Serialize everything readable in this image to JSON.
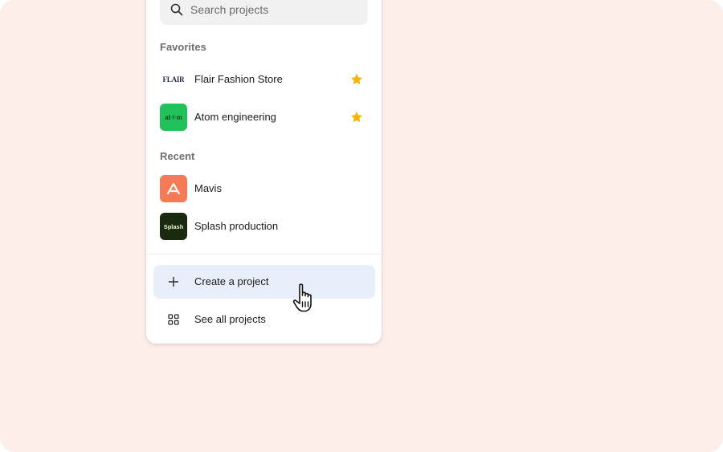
{
  "search": {
    "placeholder": "Search projects",
    "icon": "search-icon"
  },
  "favorites": {
    "label": "Favorites",
    "items": [
      {
        "name": "Flair Fashion Store",
        "logo_text": "FLAIR",
        "starred": true
      },
      {
        "name": "Atom engineering",
        "logo_text": "at⚛m",
        "starred": true
      }
    ]
  },
  "recent": {
    "label": "Recent",
    "items": [
      {
        "name": "Mavis",
        "logo_icon": "mavis-logo-icon"
      },
      {
        "name": "Splash production",
        "logo_text": "Splash"
      }
    ]
  },
  "actions": {
    "create": {
      "label": "Create a project",
      "icon": "plus-icon"
    },
    "see_all": {
      "label": "See all projects",
      "icon": "grid-icon"
    }
  },
  "colors": {
    "background": "#fdeeea",
    "star": "#f5b400",
    "hover": "#e9effa",
    "atom": "#22c25a",
    "mavis": "#f47b55",
    "splash": "#1a2a10"
  }
}
